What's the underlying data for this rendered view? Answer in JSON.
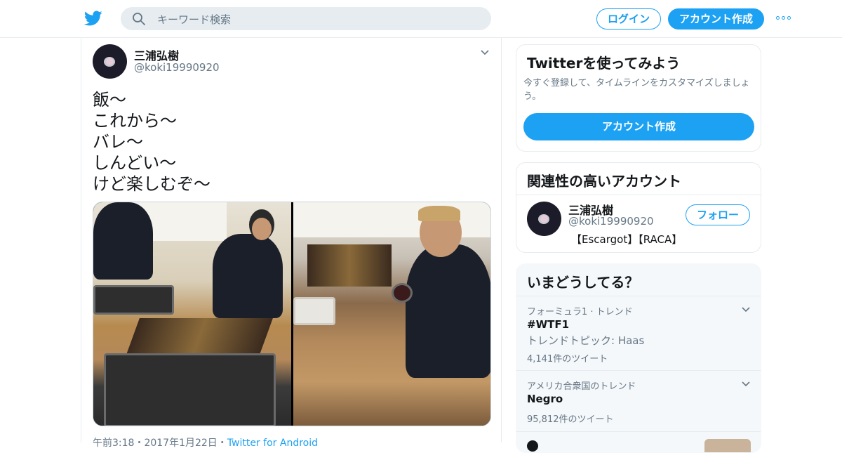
{
  "header": {
    "logo": "twitter-bird-icon",
    "search_placeholder": "キーワード検索",
    "login_label": "ログイン",
    "signup_label": "アカウント作成",
    "more_icon": "more-dots-icon",
    "accent_color": "#1da1f2"
  },
  "tweet": {
    "name": "三浦弘樹",
    "handle": "@koki19990920",
    "lines": [
      "飯～",
      "これから～",
      "バレ～",
      "しんどい～",
      "けど楽しむぞ～"
    ],
    "meta_time": "午前3:18・2017年1月22日・",
    "meta_source": "Twitter for Android"
  },
  "sidebar": {
    "signup_card": {
      "title": "Twitterを使ってみよう",
      "subtitle": "今すぐ登録して、タイムラインをカスタマイズしましょう。",
      "button": "アカウント作成"
    },
    "related": {
      "title": "関連性の高いアカウント",
      "name": "三浦弘樹",
      "handle": "@koki19990920",
      "bio": "【Escargot】【RACA】",
      "follow": "フォロー"
    },
    "trends": {
      "title": "いまどうしてる？",
      "items": [
        {
          "context": "フォーミュラ1 · トレンド",
          "name": "#WTF1",
          "topic": "トレンドトピック: Haas",
          "count": "4,141件のツイート"
        },
        {
          "context": "アメリカ合衆国のトレンド",
          "name": "Negro",
          "topic": "",
          "count": "95,812件のツイート"
        }
      ]
    }
  }
}
